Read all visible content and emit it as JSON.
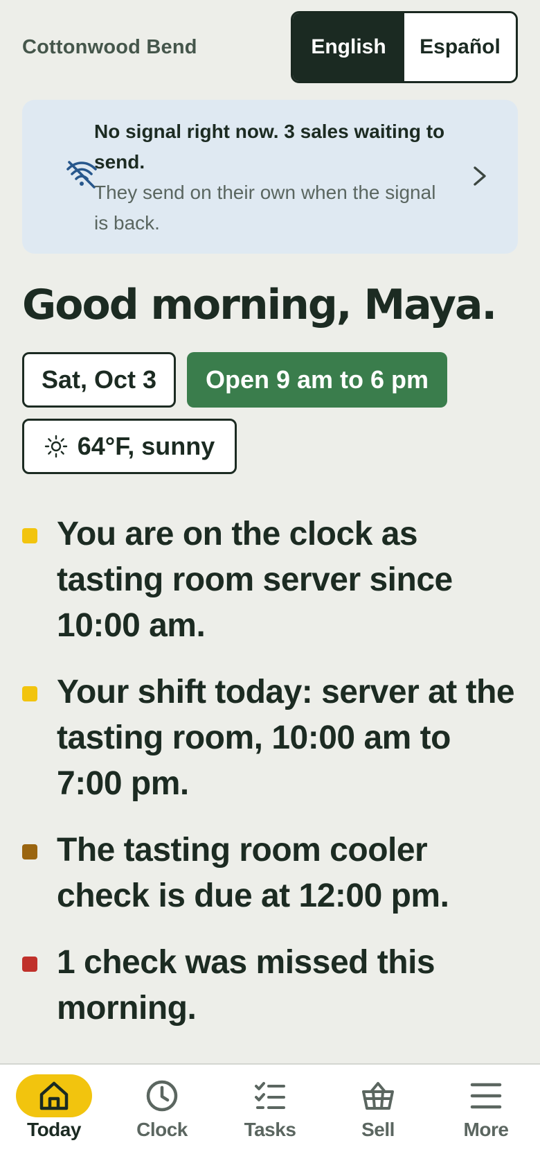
{
  "header": {
    "brand": "Cottonwood Bend",
    "languages": [
      {
        "label": "English",
        "active": true
      },
      {
        "label": "Español",
        "active": false
      }
    ]
  },
  "banner": {
    "icon": "wifi-off-icon",
    "title": "No signal right now. 3 sales waiting to send.",
    "subtitle": "They send on their own when the signal is back.",
    "color_bg": "#dfe9f2"
  },
  "greeting": "Good morning, Maya.",
  "chips": {
    "date": "Sat, Oct 3",
    "hours": "Open 9 am to 6 pm",
    "weather": "64°F, sunny",
    "weather_icon": "sun-icon"
  },
  "status_items": [
    {
      "text": "You are on the clock as tasting room server since 10:00 am.",
      "color": "#f2c40e"
    },
    {
      "text": "Your shift today: server at the tasting room, 10:00 am to 7:00 pm.",
      "color": "#f2c40e"
    },
    {
      "text": "The tasting room cooler check is due at 12:00 pm.",
      "color": "#9a6510"
    },
    {
      "text": "1 check was missed this morning.",
      "color": "#c0312b"
    }
  ],
  "nav": [
    {
      "label": "Today",
      "icon": "home-icon",
      "active": true
    },
    {
      "label": "Clock",
      "icon": "clock-icon",
      "active": false
    },
    {
      "label": "Tasks",
      "icon": "tasks-icon",
      "active": false
    },
    {
      "label": "Sell",
      "icon": "basket-icon",
      "active": false
    },
    {
      "label": "More",
      "icon": "menu-icon",
      "active": false
    }
  ],
  "colors": {
    "background": "#edeee9",
    "dark": "#1b2a22",
    "green": "#3a7d4c",
    "accent_yellow": "#f2c40e"
  }
}
